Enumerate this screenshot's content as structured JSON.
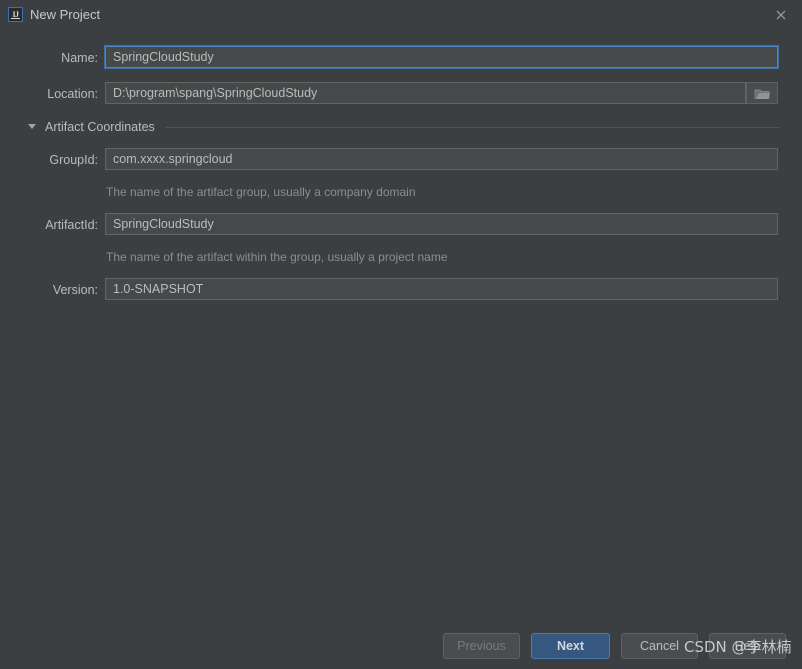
{
  "window": {
    "title": "New Project",
    "app_icon": "intellij-idea-icon",
    "close_icon": "close-icon"
  },
  "form": {
    "name": {
      "label": "Name:",
      "value": "SpringCloudStudy",
      "focused": true
    },
    "location": {
      "label": "Location:",
      "value": "D:\\program\\spang\\SpringCloudStudy",
      "browse_icon": "folder-icon"
    },
    "artifact_section": {
      "title": "Artifact Coordinates",
      "expanded": true,
      "arrow_icon": "chevron-down-icon"
    },
    "group_id": {
      "label": "GroupId:",
      "value": "com.xxxx.springcloud",
      "helper": "The name of the artifact group, usually a company domain"
    },
    "artifact_id": {
      "label": "ArtifactId:",
      "value": "SpringCloudStudy",
      "helper": "The name of the artifact within the group, usually a project name"
    },
    "version": {
      "label": "Version:",
      "value": "1.0-SNAPSHOT"
    }
  },
  "footer": {
    "previous": "Previous",
    "next": "Next",
    "cancel": "Cancel",
    "help": "Help"
  },
  "watermark": {
    "text": "CSDN @李林楠"
  },
  "colors": {
    "background": "#3c3f41",
    "field_background": "#45494a",
    "field_border": "#646464",
    "focus_border": "#4a88c7",
    "primary_button": "#365880",
    "text": "#bbbbbb",
    "helper_text": "#8b8e8f"
  }
}
